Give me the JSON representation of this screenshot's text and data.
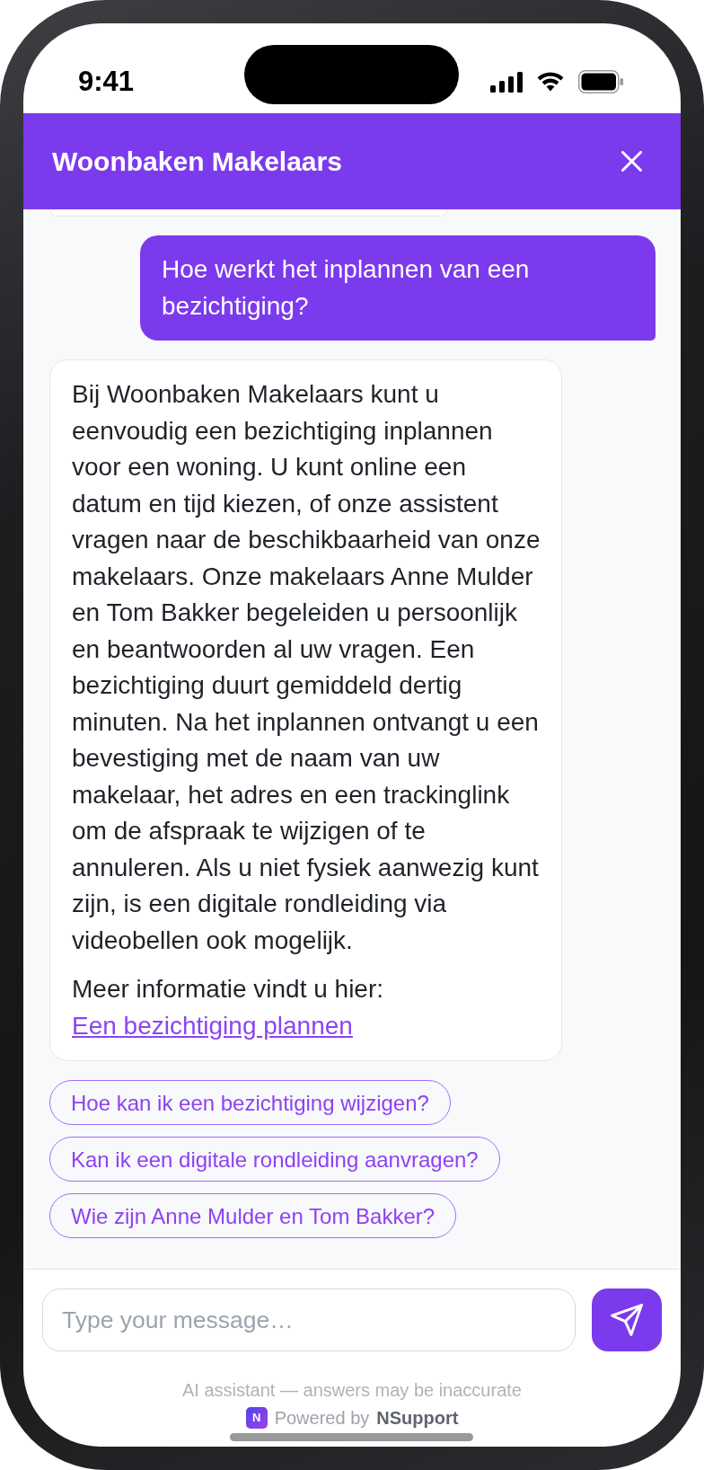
{
  "status_bar": {
    "time": "9:41"
  },
  "header": {
    "title": "Woonbaken Makelaars"
  },
  "messages": [
    {
      "kind": "assistant",
      "clipped": true
    },
    {
      "kind": "user",
      "clipped": false,
      "text": "Hoe werkt het inplannen van een bezichtiging?"
    },
    {
      "kind": "assistant",
      "clipped": false,
      "paragraphs": [
        {
          "text": "Bij Woonbaken Makelaars kunt u eenvoudig een bezichtiging inplannen voor een woning. U kunt online een datum en tijd kiezen, of onze assistent vragen naar de beschikbaarheid van onze makelaars. Onze makelaars Anne Mulder en Tom Bakker begeleiden u persoonlijk en beantwoorden al uw vragen. Een bezichtiging duurt gemiddeld dertig minuten. Na het inplannen ontvangt u een bevestiging met de naam van uw makelaar, het adres en een trackinglink om de afspraak te wijzigen of te annuleren. Als u niet fysiek aanwezig kunt zijn, is een digitale rondleiding via videobellen ook mogelijk."
        },
        {
          "text": "Meer informatie vindt u hier:",
          "link": "Een bezichtiging plannen"
        }
      ]
    }
  ],
  "suggestions": [
    "Hoe kan ik een bezichtiging wijzigen?",
    "Kan ik een digitale rondleiding aanvragen?",
    "Wie zijn Anne Mulder en Tom Bakker?"
  ],
  "composer": {
    "placeholder": "Type your message…"
  },
  "footer": {
    "disclaimer": "AI assistant — answers may be inaccurate",
    "logo": "N",
    "powered_by": "Powered by",
    "brand": "NSupport"
  }
}
